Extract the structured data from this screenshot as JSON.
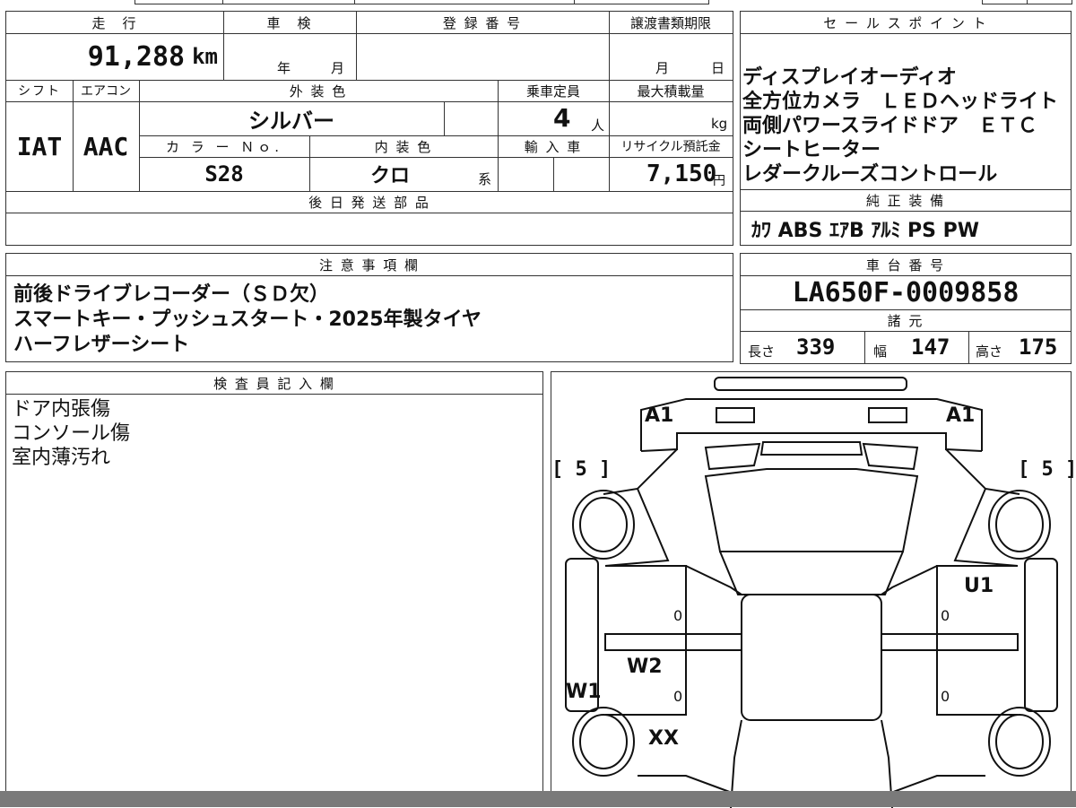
{
  "top_table": {
    "mileage_label": "走　行",
    "mileage_value": "91,288",
    "mileage_unit": "km",
    "inspection_label": "車　検",
    "inspection_year_suffix": "年",
    "inspection_month_suffix": "月",
    "registration_label": "登 録 番 号",
    "transfer_deadline_label": "譲渡書類期限",
    "transfer_month_suffix": "月",
    "transfer_day_suffix": "日",
    "shift_label": "シフト",
    "shift_value": "IAT",
    "aircon_label": "エアコン",
    "aircon_value": "AAC",
    "exterior_color_label": "外 装 色",
    "exterior_color_value": "シルバー",
    "capacity_label": "乗車定員",
    "capacity_value": "4",
    "capacity_unit": "人",
    "max_load_label": "最大積載量",
    "max_load_unit": "kg",
    "color_no_label": "カ ラ ー Ｎｏ.",
    "color_no_value": "S28",
    "interior_color_label": "内 装 色",
    "interior_color_value": "クロ",
    "interior_color_suffix": "系",
    "import_label": "輸 入 車",
    "recycle_label": "リサイクル預託金",
    "recycle_value": "7,150",
    "recycle_unit": "円",
    "later_parts_label": "後 日 発 送 部 品"
  },
  "sales_points": {
    "label": "セ ー ル ス ポ イ ン ト",
    "lines": [
      "ディスプレイオーディオ",
      "全方位カメラ　ＬＥＤヘッドライト",
      "両側パワースライドドア　ＥＴＣ",
      "シートヒーター",
      "レダークルーズコントロール"
    ]
  },
  "genuine_equipment": {
    "label": "純 正 装 備",
    "value": "ｶﾜ ABS ｴｱB ｱﾙﾐ PS PW"
  },
  "notes": {
    "label": "注 意 事 項 欄",
    "lines": [
      "前後ドライブレコーダー（ＳＤ欠）",
      "スマートキー・プッシュスタート・2025年製タイヤ",
      "ハーフレザーシート"
    ]
  },
  "chassis": {
    "label": "車 台 番 号",
    "value": "LA650F-0009858"
  },
  "specs": {
    "label": "諸 元",
    "length_label": "長さ",
    "length_value": "339",
    "width_label": "幅",
    "width_value": "147",
    "height_label": "高さ",
    "height_value": "175"
  },
  "inspector": {
    "label": "検 査 員 記 入 欄",
    "lines": [
      "ドア内張傷",
      "コンソール傷",
      "室内薄汚れ"
    ]
  },
  "diagram": {
    "front_left": "A1",
    "front_right": "A1",
    "tire_left": "[ 5 ]",
    "tire_right": "[ 5 ]",
    "right_front_door": "U1",
    "left_rear_door": "W2",
    "left_sill": "W1",
    "left_rear_wheel": "XX",
    "zero_marks": [
      "0",
      "0",
      "0",
      "0"
    ]
  }
}
